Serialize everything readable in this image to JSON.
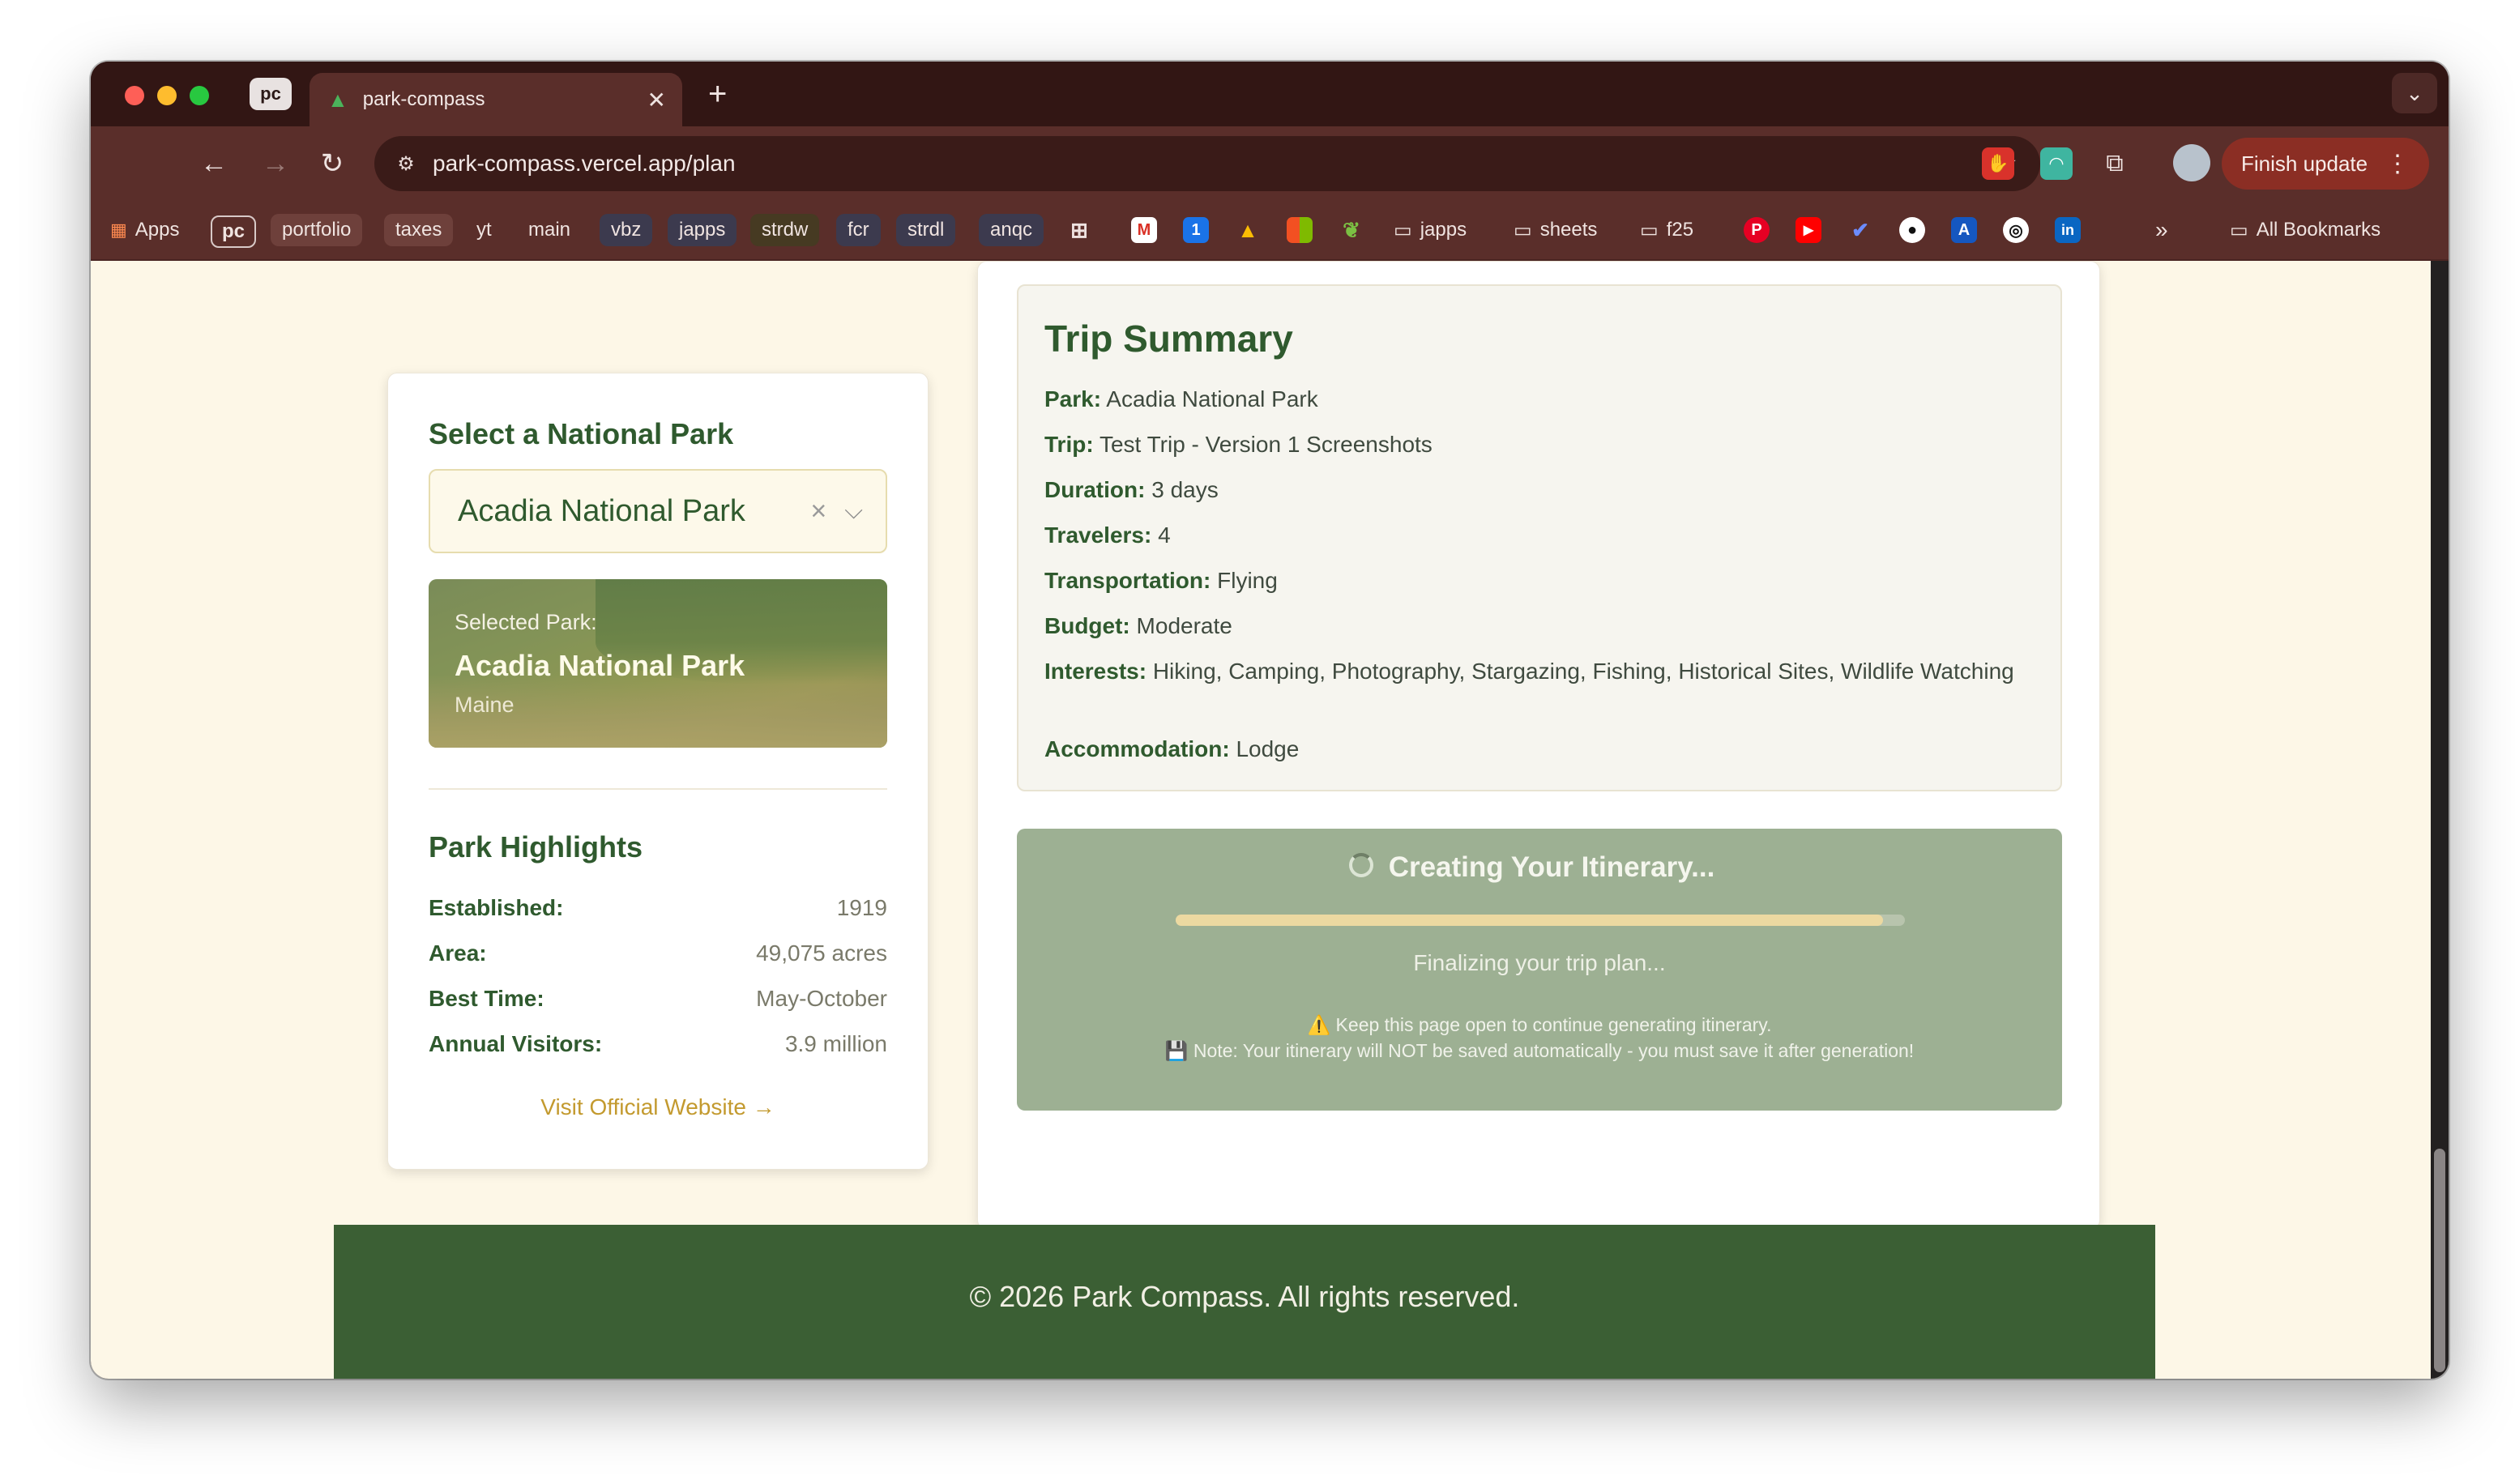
{
  "browser": {
    "pinned_tab": "pc",
    "tab_title": "park-compass",
    "new_tab": "+",
    "url": "park-compass.vercel.app/plan",
    "finish_update": "Finish update",
    "bookmarks": [
      "Apps",
      "pc",
      "portfolio",
      "taxes",
      "yt",
      "main",
      "vbz",
      "japps",
      "strdw",
      "fcr",
      "strdl",
      "anqc"
    ],
    "folders": [
      "japps",
      "sheets",
      "f25"
    ],
    "all_bookmarks": "All Bookmarks"
  },
  "left_panel": {
    "select_label": "Select a National Park",
    "selected_value": "Acadia National Park",
    "image_caption_label": "Selected Park:",
    "image_caption_name": "Acadia National Park",
    "image_caption_state": "Maine",
    "highlights_title": "Park Highlights",
    "highlights": [
      {
        "label": "Established:",
        "value": "1919"
      },
      {
        "label": "Area:",
        "value": "49,075 acres"
      },
      {
        "label": "Best Time:",
        "value": "May-October"
      },
      {
        "label": "Annual Visitors:",
        "value": "3.9 million"
      }
    ],
    "visit_link": "Visit Official Website →"
  },
  "summary": {
    "title": "Trip Summary",
    "rows": [
      {
        "label": "Park:",
        "value": "Acadia National Park"
      },
      {
        "label": "Trip:",
        "value": "Test Trip - Version 1 Screenshots"
      },
      {
        "label": "Duration:",
        "value": "3 days"
      },
      {
        "label": "Travelers:",
        "value": "4"
      },
      {
        "label": "Transportation:",
        "value": "Flying"
      },
      {
        "label": "Budget:",
        "value": "Moderate"
      },
      {
        "label": "Interests:",
        "value": "Hiking, Camping, Photography, Stargazing, Fishing, Historical Sites, Wildlife Watching"
      },
      {
        "label": "Accommodation:",
        "value": "Lodge"
      }
    ]
  },
  "loading": {
    "title": "Creating Your Itinerary...",
    "progress": 0.97,
    "status": "Finalizing your trip plan...",
    "note_line1": "⚠️ Keep this page open to continue generating itinerary.",
    "note_line2": "💾 Note: Your itinerary will NOT be saved automatically - you must save it after generation!"
  },
  "footer": {
    "copyright": "© 2026 Park Compass. All rights reserved."
  }
}
